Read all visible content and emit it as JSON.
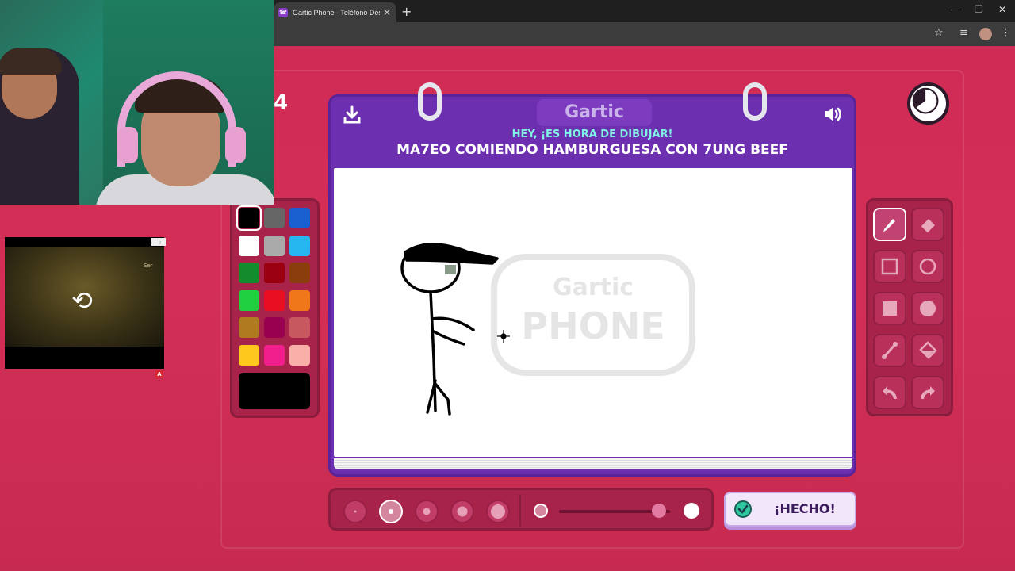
{
  "browser": {
    "tab_title": "Gartic Phone - Teléfono Descon",
    "tab_close": "✕",
    "new_tab": "+",
    "controls": [
      "—",
      "❐",
      "✕"
    ]
  },
  "game": {
    "round": "4",
    "brand": "Gartic",
    "subtitle": "HEY, ¡ES HORA DE DIBUJAR!",
    "prompt": "MA7EO COMIENDO HAMBURGUESA CON 7UNG BEEF",
    "done_label": "¡HECHO!",
    "watermark_top": "Gartic",
    "watermark_bottom": "PHONE"
  },
  "ad": {
    "brand_text": "Ser",
    "info_label": "i ⋮",
    "badge": "A"
  },
  "palette": {
    "colors": [
      "#000000",
      "#666666",
      "#1a5fd0",
      "#ffffff",
      "#aaaaaa",
      "#27b7f0",
      "#128c2d",
      "#9a0010",
      "#8a3c0a",
      "#20d040",
      "#e81020",
      "#f0781a",
      "#b07a20",
      "#9a0050",
      "#c85860",
      "#ffc81c",
      "#f01e8c",
      "#f8b0a8"
    ],
    "selected_color": "#000000"
  },
  "tools": [
    "pencil",
    "eraser",
    "rectangle",
    "ellipse",
    "filled-rectangle",
    "filled-ellipse",
    "line",
    "fill-bucket",
    "undo",
    "redo"
  ],
  "brush_sizes": [
    1,
    2,
    3,
    4,
    5
  ],
  "active_brush_size": 2,
  "opacity_level": 0.9
}
